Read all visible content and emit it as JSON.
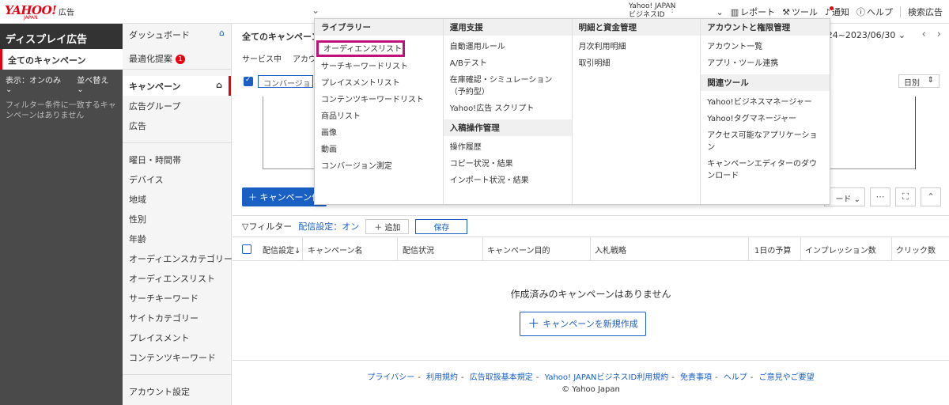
{
  "topbar": {
    "logo_text": "YAHOO!",
    "logo_sub": "JAPAN",
    "product": "広告",
    "bizid_line1": "Yahoo! JAPAN",
    "bizid_line2": "ビジネスID",
    "items": [
      {
        "icon": "report-icon",
        "label": "レポート"
      },
      {
        "icon": "tool-icon",
        "label": "ツール"
      },
      {
        "icon": "bell-icon",
        "label": "通知"
      },
      {
        "icon": "help-icon",
        "label": "ヘルプ"
      }
    ],
    "search_ads": "検索広告"
  },
  "dark_sidebar": {
    "title": "ディスプレイ広告",
    "active_item": "全てのキャンペーン",
    "display_filter": "表示：オンのみ",
    "sort": "並べ替え",
    "message": "フィルター条件に一致するキャンペーンはありません"
  },
  "nav": {
    "dashboard": "ダッシュボード",
    "optimize": "最適化提案",
    "optimize_badge": "1",
    "items_group1": [
      "キャンペーン",
      "広告グループ",
      "広告"
    ],
    "items_group2": [
      "曜日・時間帯",
      "デバイス",
      "地域",
      "性別",
      "年齢",
      "オーディエンスカテゴリー",
      "オーディエンスリスト",
      "サーチキーワード",
      "サイトカテゴリー",
      "プレイスメント",
      "コンテンツキーワード"
    ],
    "account_settings": "アカウント設定"
  },
  "main": {
    "title": "全てのキャンペーン",
    "tabs": [
      "サービス中",
      "アカウ"
    ],
    "date_range": "/24~2023/06/30",
    "conversion_select": "コンバージョン",
    "period": "日別",
    "new_campaign_short": "＋ キャンペーン作",
    "tool_select": "ード",
    "filter_label": "フィルター",
    "filter_status": "配信設定：オン",
    "add": "＋ 追加",
    "save": "保存",
    "columns": [
      "配信設定↓",
      "キャンペーン名",
      "配信状況",
      "キャンペーン目的",
      "入札戦略",
      "1日の予算",
      "インプレッション数",
      "クリック数"
    ],
    "empty_message": "作成済みのキャンペーンはありません",
    "new_campaign_button": "キャンペーンを新規作成"
  },
  "footer": {
    "links": [
      "プライバシー",
      "利用規約",
      "広告取扱基本規定",
      "Yahoo! JAPANビジネスID利用規約",
      "免責事項",
      "ヘルプ",
      "ご意見やご要望"
    ],
    "copyright": "© Yahoo Japan"
  },
  "mega_menu": {
    "col1": {
      "heading": "ライブラリー",
      "items": [
        "オーディエンスリスト",
        "サーチキーワードリスト",
        "プレイスメントリスト",
        "コンテンツキーワードリスト",
        "商品リスト",
        "画像",
        "動画",
        "コンバージョン測定"
      ]
    },
    "col2": {
      "heading": "運用支援",
      "items": [
        "自動運用ルール",
        "A/Bテスト",
        "在庫確認・シミュレーション（予約型）",
        "Yahoo!広告 スクリプト"
      ],
      "heading2": "入稿操作管理",
      "items2": [
        "操作履歴",
        "コピー状況・結果",
        "インポート状況・結果"
      ]
    },
    "col3": {
      "heading": "明細と資金管理",
      "items": [
        "月次利用明細",
        "取引明細"
      ]
    },
    "col4": {
      "heading": "アカウントと権限管理",
      "items": [
        "アカウント一覧",
        "アプリ・ツール連携"
      ],
      "heading2": "関連ツール",
      "items2": [
        "Yahoo!ビジネスマネージャー",
        "Yahoo!タグマネージャー",
        "アクセス可能なアプリケーション",
        "キャンペーンエディターのダウンロード"
      ]
    }
  },
  "colors": {
    "brand_red": "#e60012",
    "link_blue": "#1a5fc4",
    "highlight": "#c0117a"
  }
}
